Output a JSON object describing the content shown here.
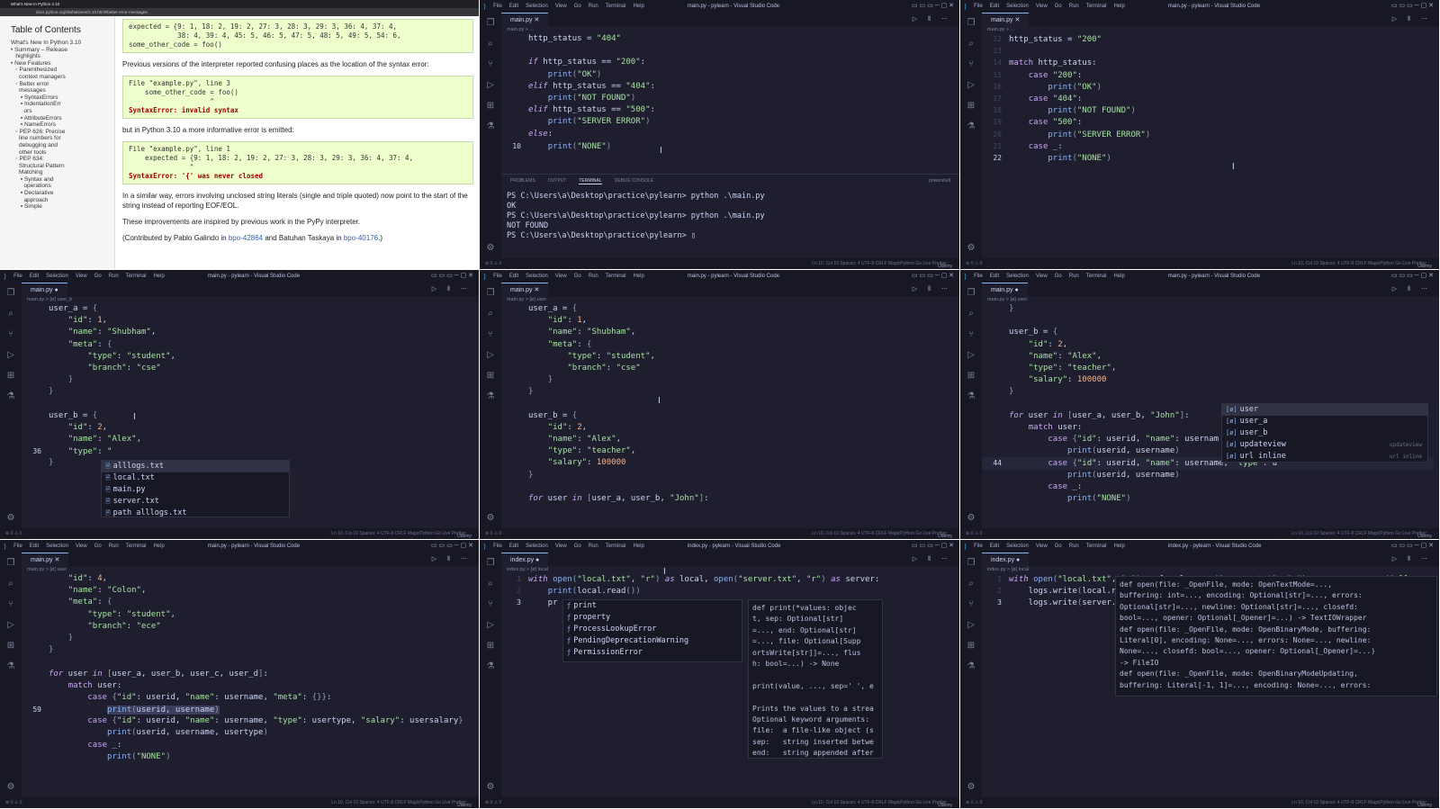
{
  "app": {
    "window_title": "main.py - pylearn - Visual Studio Code",
    "window_title_index": "index.py - pylearn - Visual Studio Code",
    "menu": [
      "File",
      "Edit",
      "Selection",
      "View",
      "Go",
      "Run",
      "Terminal",
      "Help"
    ],
    "watermark": "Udemy",
    "status_text": "Ln 10, Col 19   Spaces: 4   UTF-8   CRLF   MagicPython   Go Live   Prettier"
  },
  "browser": {
    "tab_title": "What's New In Python 3.10",
    "url": "docs.python.org/3/whatsnew/3.10.html#better-error-messages",
    "toc_title": "Table of Contents",
    "toc_items": [
      "What's New In Python 3.10",
      "• Summary – Release",
      "   highlights",
      "• New Features",
      "   ◦ Parenthesized",
      "     context managers",
      "   ◦ Better error",
      "     messages",
      "      ▪ SyntaxErrors",
      "      ▪ IndentationErr",
      "        ors",
      "      ▪ AttributeErrors",
      "      ▪ NameErrors",
      "   ◦ PEP 626: Precise",
      "     line numbers for",
      "     debugging and",
      "     other tools",
      "   ◦ PEP 634:",
      "     Structural Pattern",
      "     Matching",
      "      ▪ Syntax and",
      "        operations",
      "      ▪ Declarative",
      "        approach",
      "      ▪ Simple"
    ],
    "code1": "expected = {9: 1, 18: 2, 19: 2, 27: 3, 28: 3, 29: 3, 36: 4, 37: 4,\n            38: 4, 39: 4, 45: 5, 46: 5, 47: 5, 48: 5, 49: 5, 54: 6,\nsome_other_code = foo()",
    "para1": "Previous versions of the interpreter reported confusing places as the location of the syntax error:",
    "code2a": "File \"example.py\", line 3\n    some_other_code = foo()\n                    ^",
    "code2b": "SyntaxError: invalid syntax",
    "para2": "but in Python 3.10 a more informative error is emitted:",
    "code3a": "File \"example.py\", line 1\n    expected = {9: 1, 18: 2, 19: 2, 27: 3, 28: 3, 29: 3, 36: 4, 37: 4,\n               ^",
    "code3b": "SyntaxError: '{' was never closed",
    "para3": "In a similar way, errors involving unclosed string literals (single and triple quoted) now point to the start of the string instead of reporting EOF/EOL.",
    "para4": "These improvements are inspired by previous work in the PyPy interpreter.",
    "credit_prefix": "(Contributed by Pablo Galindo in ",
    "credit_link1": "bpo-42864",
    "credit_mid": " and Batuhan Taskaya in ",
    "credit_link2": "bpo-40176",
    "credit_suffix": ".)"
  },
  "panes": {
    "p2": {
      "tab": "main.py",
      "crumb": "main.py > ...",
      "panel_tabs": [
        "PROBLEMS",
        "OUTPUT",
        "TERMINAL",
        "DEBUG CONSOLE"
      ],
      "panel_shell": "powershell",
      "terminal": "PS C:\\Users\\a\\Desktop\\practice\\pylearn> python .\\main.py\nOK\nPS C:\\Users\\a\\Desktop\\practice\\pylearn> python .\\main.py\nNOT FOUND\nPS C:\\Users\\a\\Desktop\\practice\\pylearn> ▯"
    },
    "p3": {
      "tab": "main.py",
      "crumb": "main.py > ..."
    },
    "p4": {
      "tab": "main.py",
      "crumb": "main.py > [ø] user_b",
      "suggest": [
        "alllogs.txt",
        "local.txt",
        "main.py",
        "server.txt",
        "path alllogs.txt"
      ]
    },
    "p5": {
      "tab": "main.py",
      "crumb": "main.py > [ø] user"
    },
    "p6": {
      "tab": "main.py",
      "crumb": "main.py > [ø] user",
      "suggest": [
        "user",
        "user_a",
        "user_b",
        "updateview",
        "url inline"
      ],
      "suggest_detail": [
        "",
        "",
        "",
        "updateview",
        "url inline"
      ]
    },
    "p7": {
      "tab": "main.py",
      "crumb": "main.py > [ø] user"
    },
    "p8": {
      "tab": "index.py",
      "crumb": "index.py > [ø] local",
      "suggest": [
        "print",
        "property",
        "ProcessLookupError",
        "PendingDeprecationWarning",
        "PermissionError"
      ],
      "doc": "def print(*values: objec\nt, sep: Optional[str]\n=..., end: Optional[str]\n=..., file: Optional[Supp\nortsWrite[str]]=..., flus\nh: bool=...) -> None\n\nprint(value, ..., sep=' ', e\n\nPrints the values to a strea\nOptional keyword arguments:\nfile:  a file-like object (s\nsep:   string inserted betwe\nend:   string appended after"
    },
    "p9": {
      "tab": "index.py",
      "crumb": "index.py > [ø] local",
      "doc": "def open(file: _OpenFile, mode: OpenTextMode=...,\nbuffering: int=..., encoding: Optional[str]=..., errors:\nOptional[str]=..., newline: Optional[str]=..., closefd:\nbool=..., opener: Optional[_Opener]=...) -> TextIOWrapper\ndef open(file: _OpenFile, mode: OpenBinaryMode, buffering:\nLiteral[0], encoding: None=..., errors: None=..., newline:\nNone=..., closefd: bool=..., opener: Optional[_Opener]=...)\n-> FileIO\ndef open(file: _OpenFile, mode: OpenBinaryModeUpdating,\nbuffering: Literal[-1, 1]=..., encoding: None=..., errors:"
    }
  },
  "colors": {
    "editor_bg": "#1e1e2e",
    "string": "#a6e3a1",
    "keyword": "#cba6f7",
    "number": "#fab387",
    "function": "#89b4fa",
    "browser_code_bg": "#eeffcc"
  }
}
